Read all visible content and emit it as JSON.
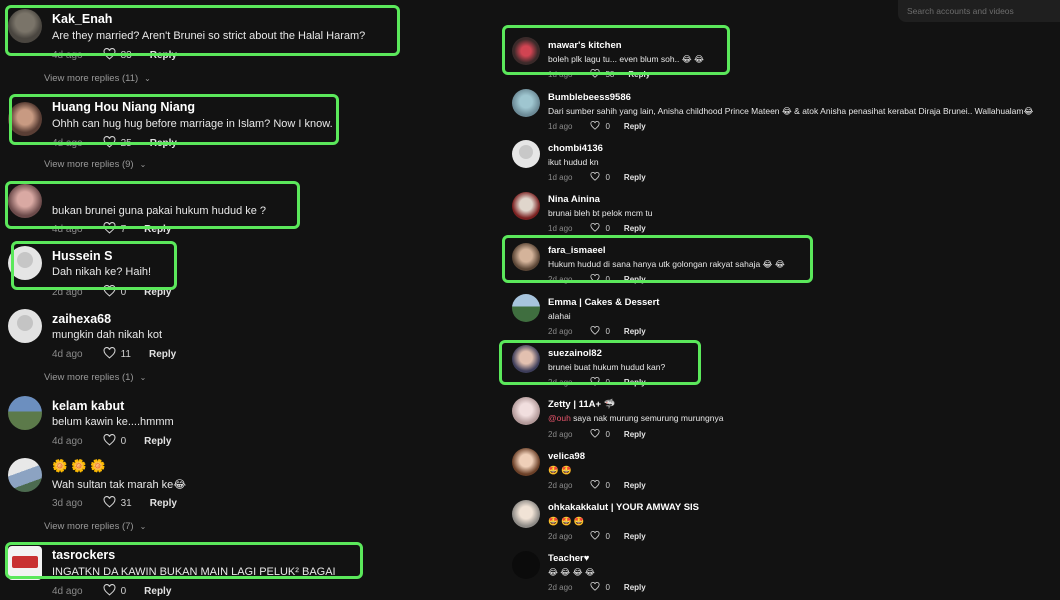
{
  "search": {
    "placeholder": "Search accounts and videos"
  },
  "colors": {
    "highlight": "#5be85b",
    "background": "#121212",
    "mention": "#e8546b"
  },
  "left_comments": [
    {
      "username": "Kak_Enah",
      "text": "Are they married? Aren't Brunei so strict about the Halal Haram?",
      "time": "4d ago",
      "likes": "83",
      "reply": "Reply",
      "view_more": "View more replies (11)"
    },
    {
      "username": "Huang Hou Niang Niang",
      "text": "Ohhh can hug hug before marriage in Islam? Now I know.",
      "time": "4d ago",
      "likes": "25",
      "reply": "Reply",
      "view_more": "View more replies (9)"
    },
    {
      "username": "",
      "text": "bukan brunei guna pakai hukum hudud ke ?",
      "time": "4d ago",
      "likes": "7",
      "reply": "Reply"
    },
    {
      "username": "Hussein S",
      "text": "Dah nikah ke? Haih!",
      "time": "2d ago",
      "likes": "0",
      "reply": "Reply"
    },
    {
      "username": "zaihexa68",
      "text": "mungkin dah nikah kot",
      "time": "4d ago",
      "likes": "11",
      "reply": "Reply",
      "view_more": "View more replies (1)"
    },
    {
      "username": "kelam kabut",
      "text": "belum kawin ke....hmmm",
      "time": "4d ago",
      "likes": "0",
      "reply": "Reply"
    },
    {
      "username": "🌼 🌼 🌼",
      "text": "Wah sultan tak marah ke😂",
      "time": "3d ago",
      "likes": "31",
      "reply": "Reply",
      "view_more": "View more replies (7)"
    },
    {
      "username": "tasrockers",
      "text": "INGATKN DA KAWIN BUKAN MAIN LAGI PELUK² BAGAI",
      "time": "4d ago",
      "likes": "0",
      "reply": "Reply"
    }
  ],
  "right_comments": [
    {
      "username": "mawar's kitchen",
      "text": "boleh plk lagu tu... even blum soh.. 😂 😂",
      "time": "1d ago",
      "likes": "58",
      "reply": "Reply"
    },
    {
      "username": "Bumblebeess9586",
      "text": "Dari sumber sahih yang lain, Anisha childhood Prince Mateen 😂 & atok Anisha penasihat kerabat Diraja Brunei.. Wallahualam😂",
      "time": "1d ago",
      "likes": "0",
      "reply": "Reply"
    },
    {
      "username": "chombi4136",
      "text": "ikut hudud kn",
      "time": "1d ago",
      "likes": "0",
      "reply": "Reply"
    },
    {
      "username": "Nina Ainina",
      "text": "brunai bleh bt pelok mcm tu",
      "time": "1d ago",
      "likes": "0",
      "reply": "Reply"
    },
    {
      "username": "fara_ismaeel",
      "text": "Hukum hudud di sana hanya utk golongan rakyat sahaja 😂 😂",
      "time": "2d ago",
      "likes": "0",
      "reply": "Reply"
    },
    {
      "username": "Emma | Cakes & Dessert",
      "text": "alahai",
      "time": "2d ago",
      "likes": "0",
      "reply": "Reply"
    },
    {
      "username": "suezainol82",
      "text": "brunei buat hukum hudud kan?",
      "time": "2d ago",
      "likes": "0",
      "reply": "Reply"
    },
    {
      "username": "Zetty | 11A+ 🦈",
      "mention": "@ouh",
      "text": " saya nak murung semurung murungnya",
      "time": "2d ago",
      "likes": "0",
      "reply": "Reply"
    },
    {
      "username": "velica98",
      "text": "🤩 🤩",
      "time": "2d ago",
      "likes": "0",
      "reply": "Reply"
    },
    {
      "username": "ohkakakkalut | YOUR AMWAY SIS",
      "text": "🤩 🤩 🤩",
      "time": "2d ago",
      "likes": "0",
      "reply": "Reply"
    },
    {
      "username": "Teacher♥",
      "text": "😂 😂 😂 😂",
      "time": "2d ago",
      "likes": "0",
      "reply": "Reply"
    }
  ]
}
